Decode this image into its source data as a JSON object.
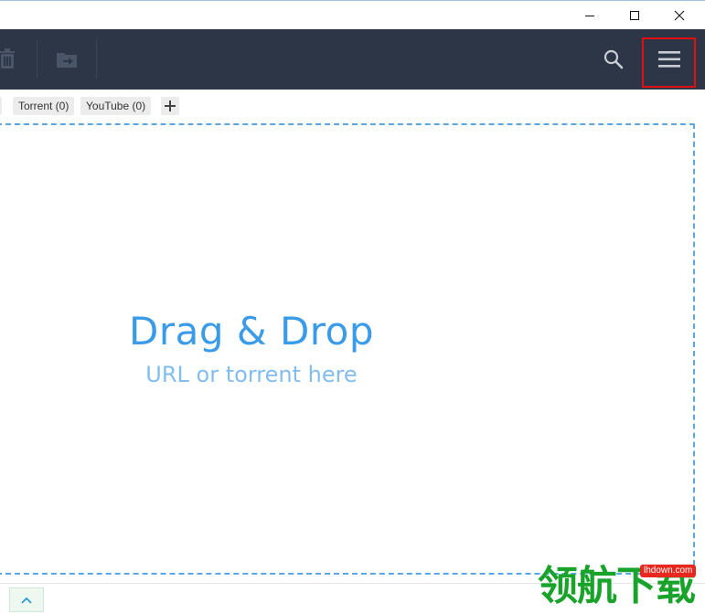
{
  "window": {
    "minimize_icon": "minimize-icon",
    "maximize_icon": "maximize-icon",
    "close_icon": "close-icon"
  },
  "toolbar": {
    "icons": [
      "trash-icon",
      "move-to-folder-icon",
      "search-icon",
      "hamburger-menu-icon"
    ],
    "menu_highlight_color": "#e01010",
    "background": "#2d3646"
  },
  "tabs": {
    "items": [
      {
        "label": ""
      },
      {
        "label": "Torrent (0)"
      },
      {
        "label": "YouTube (0)"
      }
    ],
    "add_label": "+"
  },
  "dropzone": {
    "title": "Drag & Drop",
    "subtitle": "URL or torrent here",
    "accent": "#3a9be8"
  },
  "statusbar": {
    "expand_icon": "chevron-up-icon"
  },
  "watermark": {
    "text": "领航下载",
    "url": "lhdown.com"
  }
}
